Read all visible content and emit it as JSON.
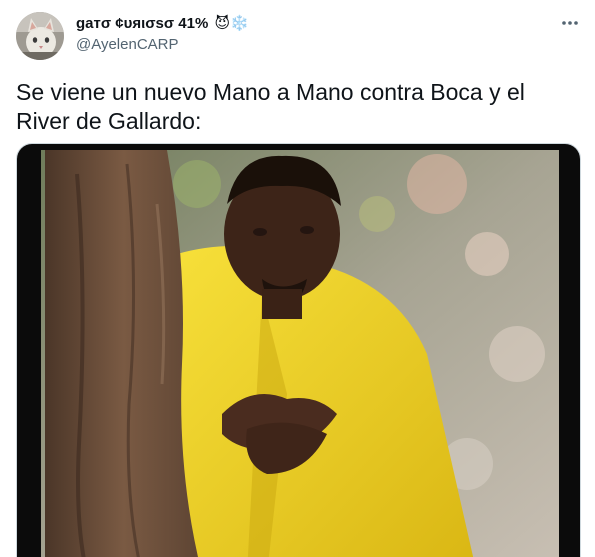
{
  "tweet": {
    "display_name": "gaтσ ¢υяισѕσ 41%",
    "display_emojis": "😈❄️",
    "handle": "@AyelenCARP",
    "text": "Se viene un nuevo Mano a Mano contra Boca y el River de Gallardo:",
    "more_icon": "more-horizontal-icon",
    "avatar_icon": "cat-avatar"
  },
  "colors": {
    "text": "#0f1419",
    "secondary": "#536471",
    "border": "#cfd9de",
    "suit": "#f2d21f",
    "tree": "#7a5a43"
  }
}
